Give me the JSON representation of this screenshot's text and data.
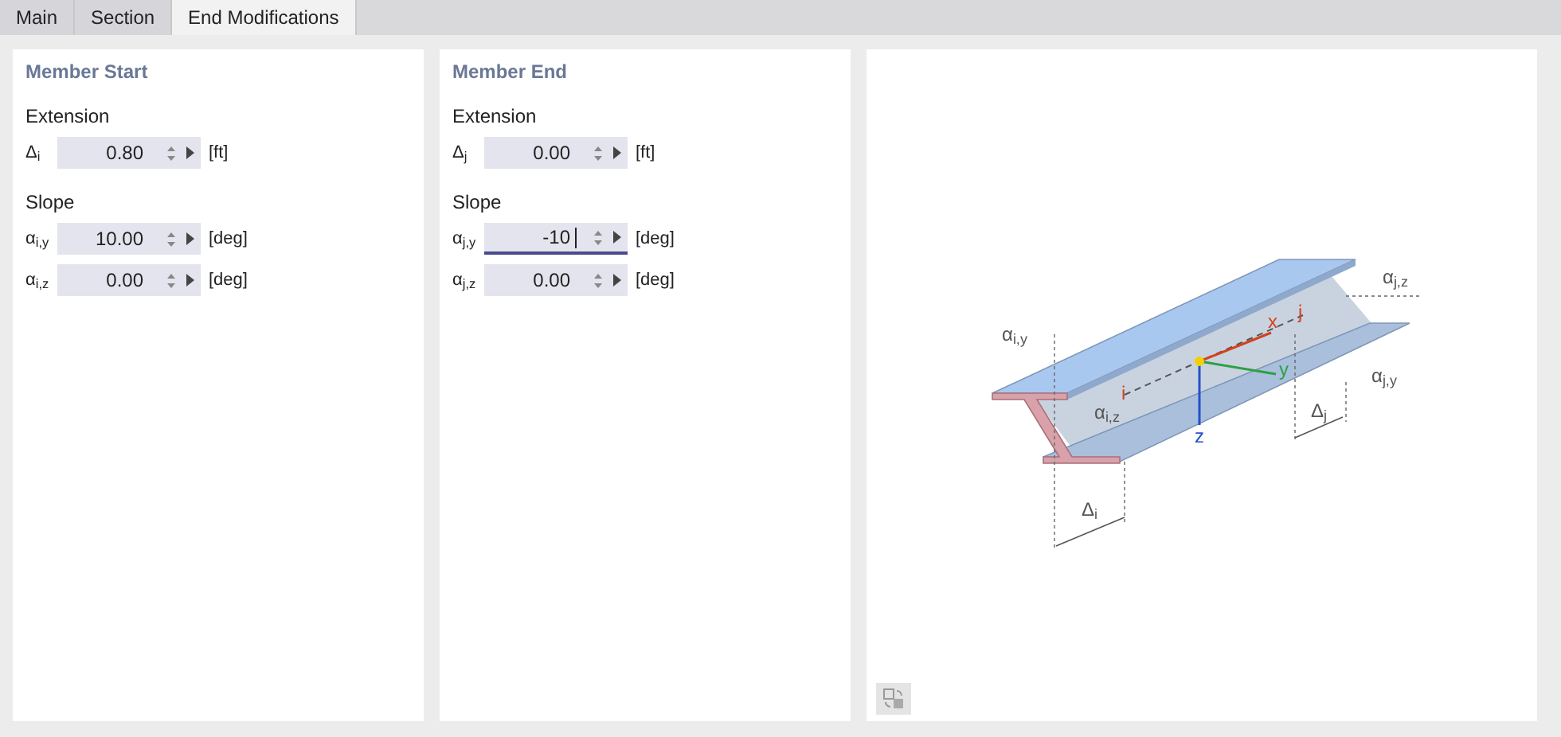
{
  "tabs": [
    {
      "label": "Main",
      "selected": false
    },
    {
      "label": "Section",
      "selected": false
    },
    {
      "label": "End Modifications",
      "selected": true
    }
  ],
  "panels": [
    {
      "title": "Member Start",
      "groups": [
        {
          "title": "Extension",
          "fields": [
            {
              "label": "Δ$_{i}$",
              "value": "0.80",
              "unit": "[ft]",
              "focused": false
            }
          ]
        },
        {
          "title": "Slope",
          "fields": [
            {
              "label": "α$_{i,y}$",
              "value": "10.00",
              "unit": "[deg]",
              "focused": false
            },
            {
              "label": "α$_{i,z}$",
              "value": "0.00",
              "unit": "[deg]",
              "focused": false
            }
          ]
        }
      ]
    },
    {
      "title": "Member End",
      "groups": [
        {
          "title": "Extension",
          "fields": [
            {
              "label": "Δ$_{j}$",
              "value": "0.00",
              "unit": "[ft]",
              "focused": false
            }
          ]
        },
        {
          "title": "Slope",
          "fields": [
            {
              "label": "α$_{j,y}$",
              "value": "-10",
              "unit": "[deg]",
              "focused": true
            },
            {
              "label": "α$_{j,z}$",
              "value": "0.00",
              "unit": "[deg]",
              "focused": false
            }
          ]
        }
      ]
    }
  ],
  "diagram_labels": [
    {
      "text": "α$_{j,z}$",
      "kind": "dim"
    },
    {
      "text": "j",
      "kind": "node"
    },
    {
      "text": "x",
      "kind": "x"
    },
    {
      "text": "α$_{i,y}$",
      "kind": "dim"
    },
    {
      "text": "y",
      "kind": "y"
    },
    {
      "text": "α$_{j,y}$",
      "kind": "dim"
    },
    {
      "text": "i",
      "kind": "node"
    },
    {
      "text": "α$_{i,z}$",
      "kind": "dim"
    },
    {
      "text": "Δ$_{j}$",
      "kind": "dim"
    },
    {
      "text": "z",
      "kind": "z"
    },
    {
      "text": "Δ$_{i}$",
      "kind": "dim"
    }
  ]
}
